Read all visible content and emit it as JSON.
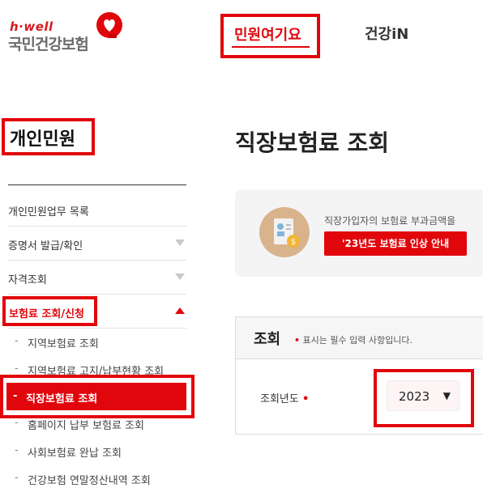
{
  "header": {
    "logo_tagline": "h·well",
    "logo_name": "국민건강보험",
    "nav": [
      {
        "label": "민원여기요"
      },
      {
        "label": "건강iN"
      }
    ]
  },
  "sidebar": {
    "title": "개인민원",
    "items": [
      {
        "label": "개인민원업무 목록"
      },
      {
        "label": "증명서 발급/확인"
      },
      {
        "label": "자격조회"
      },
      {
        "label": "보험료 조회/신청"
      }
    ],
    "sub_items": [
      {
        "label": "지역보험료 조회"
      },
      {
        "label": "지역보험료 고지/납부현황 조회"
      },
      {
        "label": "직장보험료 조회"
      },
      {
        "label": "홈페이지 납부 보험료 조회"
      },
      {
        "label": "사회보험료 완납 조회"
      },
      {
        "label": "건강보험 연말정산내역 조회"
      }
    ],
    "dash": "-"
  },
  "main": {
    "title": "직장보험료 조회",
    "info": {
      "text": "직장가입자의 보험료 부과금액을",
      "button_label": "'23년도 보험료 인상 안내"
    },
    "query": {
      "heading": "조회",
      "required_note": "표시는 필수 입력 사항입니다.",
      "required_mark": "•",
      "year_label": "조회년도",
      "year_value": "2023",
      "chevron": "⌄"
    }
  },
  "colors": {
    "accent": "#e1060c",
    "highlight_outline": "#e1060c"
  }
}
